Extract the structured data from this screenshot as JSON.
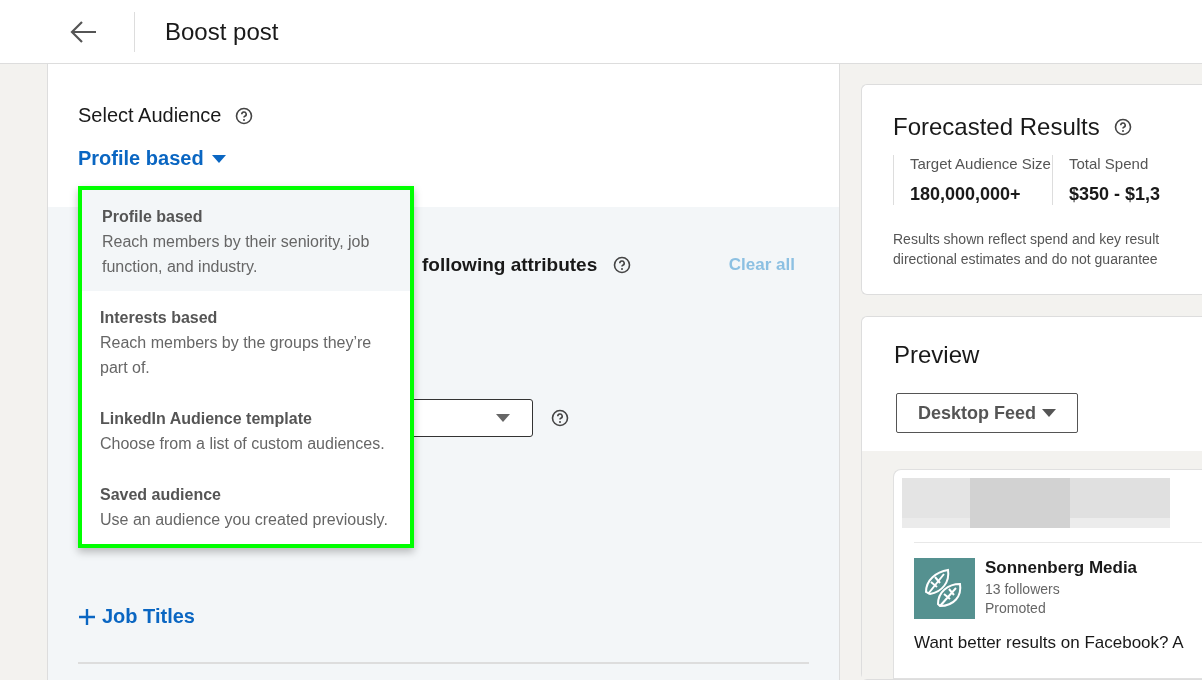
{
  "header": {
    "title": "Boost post"
  },
  "audience": {
    "label": "Select Audience",
    "selector": "Profile based",
    "menu": [
      {
        "title": "Profile based",
        "description": "Reach members by their seniority, job function, and industry.",
        "selected": true
      },
      {
        "title": "Interests based",
        "description": "Reach members by the groups they’re part of.",
        "selected": false
      },
      {
        "title": "LinkedIn Audience template",
        "description": "Choose from a list of custom audiences.",
        "selected": false
      },
      {
        "title": "Saved audience",
        "description": "Use an audience you created previously.",
        "selected": false
      }
    ]
  },
  "attributes": {
    "heading": "following attributes",
    "clear": "Clear all",
    "add_link": "Job Titles"
  },
  "forecast": {
    "title": "Forecasted Results",
    "metrics": [
      {
        "label": "Target Audience Size",
        "value": "180,000,000+"
      },
      {
        "label": "Total Spend",
        "value": "$350 - $1,3"
      }
    ],
    "note": [
      "Results shown reflect spend and key result",
      "directional estimates and do not guarantee"
    ]
  },
  "preview": {
    "title": "Preview",
    "placement": "Desktop Feed",
    "post": {
      "company": "Sonnenberg Media",
      "followers": "13 followers",
      "label": "Promoted",
      "text": "Want better results on Facebook? A"
    }
  }
}
